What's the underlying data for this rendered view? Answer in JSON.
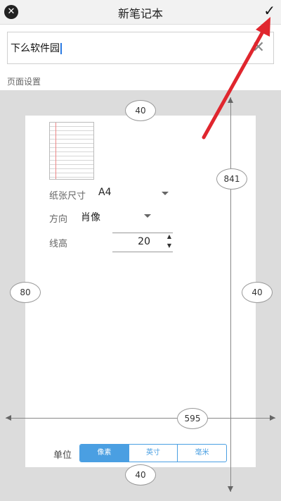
{
  "header": {
    "title": "新笔记本",
    "close_icon": "✕",
    "confirm_icon": "✓"
  },
  "name_field": {
    "value": "下么软件园",
    "clear_icon": "✕"
  },
  "section": {
    "page_settings": "页面设置"
  },
  "margins": {
    "top": "40",
    "left": "80",
    "right": "40",
    "bottom": "40"
  },
  "dimensions": {
    "height": "841",
    "width": "595"
  },
  "settings": {
    "paper_size_label": "纸张尺寸",
    "paper_size_value": "A4",
    "orientation_label": "方向",
    "orientation_value": "肖像",
    "line_height_label": "线高",
    "line_height_value": "20"
  },
  "units": {
    "label": "单位",
    "options": [
      "像素",
      "英寸",
      "毫米"
    ],
    "selected": "像素"
  },
  "colors": {
    "accent": "#4a9fe2",
    "annotation": "#e0262e",
    "margin_gray": "#dcdcdc"
  }
}
